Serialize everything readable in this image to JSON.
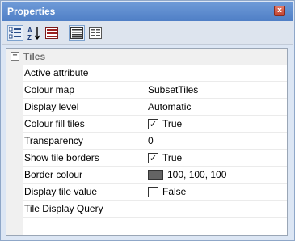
{
  "window": {
    "title": "Properties",
    "close_glyph": "x"
  },
  "toolbar": {
    "buttons": [
      {
        "icon": "categorized-icon",
        "active": true
      },
      {
        "icon": "sort-az-icon",
        "active": false
      },
      {
        "icon": "property-pages-icon",
        "active": false
      },
      {
        "icon": "show-description-icon",
        "active": true
      },
      {
        "icon": "list-view-icon",
        "active": false
      }
    ],
    "sort_letters": "A Z"
  },
  "category": {
    "toggle": "−",
    "label": "Tiles"
  },
  "properties": [
    {
      "name": "Active attribute",
      "value": ""
    },
    {
      "name": "Colour map",
      "value": "SubsetTiles"
    },
    {
      "name": "Display level",
      "value": "Automatic"
    },
    {
      "name": "Colour fill tiles",
      "value": "True",
      "checkbox": true,
      "checked": true
    },
    {
      "name": "Transparency",
      "value": "0"
    },
    {
      "name": "Show tile borders",
      "value": "True",
      "checkbox": true,
      "checked": true
    },
    {
      "name": "Border colour",
      "value": "100, 100, 100",
      "swatch": "#646464"
    },
    {
      "name": "Display tile value",
      "value": "False",
      "checkbox": true,
      "checked": false
    },
    {
      "name": "Tile Display Query",
      "value": ""
    }
  ],
  "colors": {
    "title_bar": "#5b8ad0",
    "window_frame": "#dce6f4",
    "gutter": "#f0f0f0",
    "category_text": "#6d6d6d"
  }
}
